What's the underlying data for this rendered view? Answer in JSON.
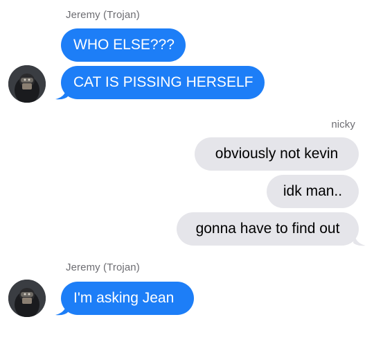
{
  "colors": {
    "incoming_bubble": "#1d7ef7",
    "outgoing_bubble": "#e5e5ea",
    "sender_label": "#6d6d72"
  },
  "thread": {
    "group1": {
      "sender": "Jeremy (Trojan)",
      "messages": [
        "WHO ELSE???",
        "CAT IS PISSING HERSELF"
      ],
      "avatar_icon": "contact-photo-avatar"
    },
    "group2": {
      "sender": "nicky",
      "messages": [
        "obviously not kevin",
        "idk man..",
        "gonna have to find out"
      ]
    },
    "group3": {
      "sender": "Jeremy (Trojan)",
      "messages": [
        "I'm asking Jean"
      ],
      "avatar_icon": "contact-photo-avatar"
    }
  }
}
